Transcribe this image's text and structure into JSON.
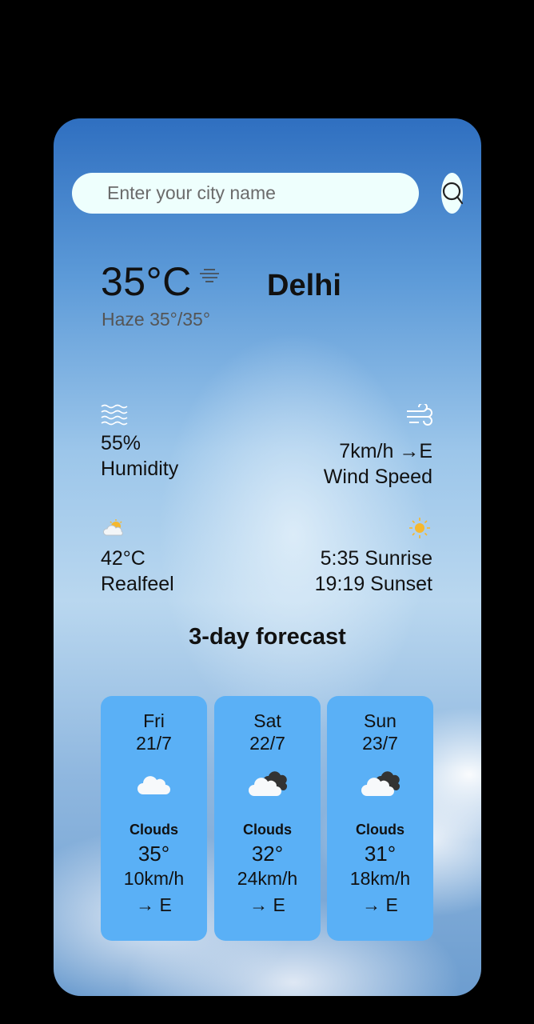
{
  "search": {
    "placeholder": "Enter your city name"
  },
  "current": {
    "temperature": "35°C",
    "description": "Haze 35°/35°",
    "city": "Delhi",
    "icon": "haze-icon"
  },
  "stats": {
    "humidity_value": "55%",
    "humidity_label": "Humidity",
    "wind_value": "7km/h →E",
    "wind_label": "Wind Speed",
    "realfeel_value": "42°C",
    "realfeel_label": "Realfeel",
    "sunrise": "5:35 Sunrise",
    "sunset": "19:19 Sunset"
  },
  "forecast_title": "3-day forecast",
  "forecast": [
    {
      "day": "Fri",
      "date": "21/7",
      "icon": "cloud-icon",
      "condition": "Clouds",
      "temp": "35°",
      "wind": "10km/h",
      "dir": "→ E"
    },
    {
      "day": "Sat",
      "date": "22/7",
      "icon": "broken-clouds-icon",
      "condition": "Clouds",
      "temp": "32°",
      "wind": "24km/h",
      "dir": "→ E"
    },
    {
      "day": "Sun",
      "date": "23/7",
      "icon": "broken-clouds-icon",
      "condition": "Clouds",
      "temp": "31°",
      "wind": "18km/h",
      "dir": "→ E"
    }
  ],
  "colors": {
    "card_bg": "#5ab0f6",
    "search_bg": "#eefffd"
  }
}
